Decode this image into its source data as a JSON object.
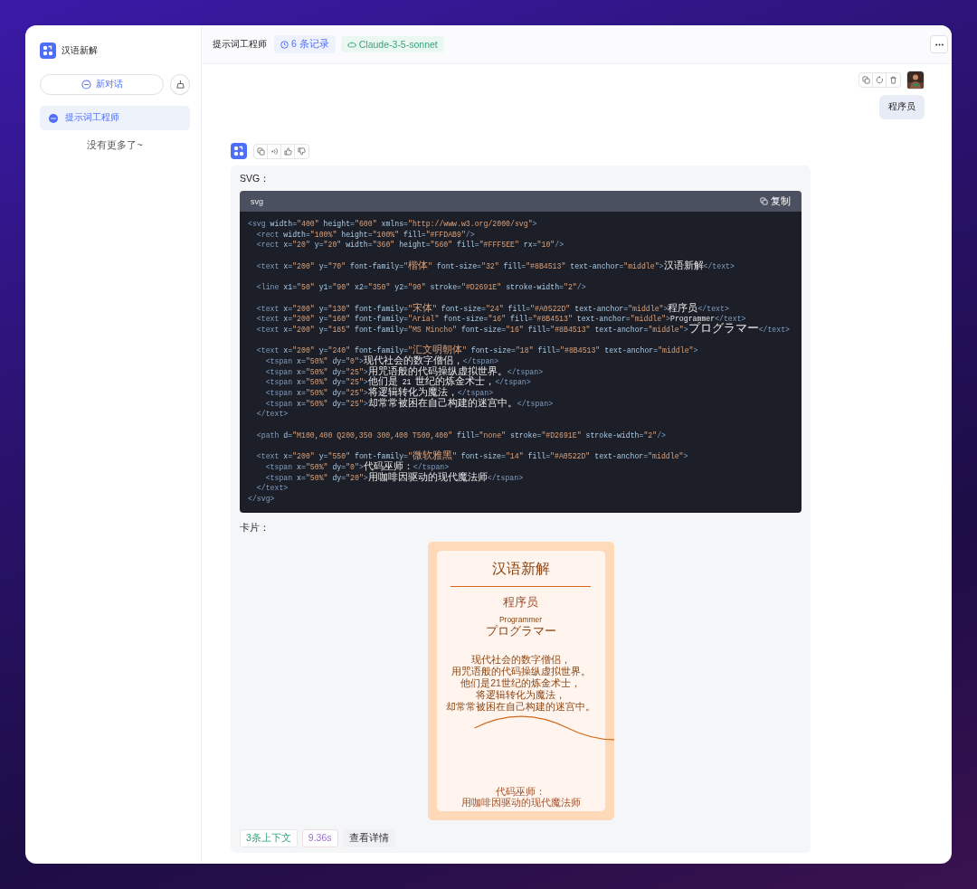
{
  "sidebar": {
    "app_name": "汉语新解",
    "new_chat_button": "新对话",
    "conversations": [
      {
        "title": "提示词工程师",
        "selected": true
      }
    ],
    "end_note": "没有更多了~"
  },
  "header": {
    "title": "提示词工程师",
    "badges": [
      {
        "kind": "records",
        "text": "6 条记录"
      },
      {
        "kind": "model",
        "text": "Claude-3-5-sonnet"
      }
    ]
  },
  "user_message": {
    "text": "程序员"
  },
  "assistant_message": {
    "blocks": [
      {
        "kind": "paragraph",
        "text": "SVG："
      },
      {
        "kind": "code",
        "language": "svg",
        "copy_label": "复制",
        "code": "<svg width=\"400\" height=\"600\" xmlns=\"http://www.w3.org/2000/svg\">\n  <rect width=\"100%\" height=\"100%\" fill=\"#FFDAB9\"/>\n  <rect x=\"20\" y=\"20\" width=\"360\" height=\"560\" fill=\"#FFF5EE\" rx=\"10\"/>\n\n  <text x=\"200\" y=\"70\" font-family=\"楷体\" font-size=\"32\" fill=\"#8B4513\" text-anchor=\"middle\">汉语新解</text>\n\n  <line x1=\"50\" y1=\"90\" x2=\"350\" y2=\"90\" stroke=\"#D2691E\" stroke-width=\"2\"/>\n\n  <text x=\"200\" y=\"130\" font-family=\"宋体\" font-size=\"24\" fill=\"#A0522D\" text-anchor=\"middle\">程序员</text>\n  <text x=\"200\" y=\"160\" font-family=\"Arial\" font-size=\"16\" fill=\"#8B4513\" text-anchor=\"middle\">Programmer</text>\n  <text x=\"200\" y=\"185\" font-family=\"MS Mincho\" font-size=\"16\" fill=\"#8B4513\" text-anchor=\"middle\">プログラマー</text>\n\n  <text x=\"200\" y=\"240\" font-family=\"汇文明朝体\" font-size=\"18\" fill=\"#8B4513\" text-anchor=\"middle\">\n    <tspan x=\"50%\" dy=\"0\">现代社会的数字僧侣，</tspan>\n    <tspan x=\"50%\" dy=\"25\">用咒语般的代码操纵虚拟世界。</tspan>\n    <tspan x=\"50%\" dy=\"25\">他们是 21 世纪的炼金术士，</tspan>\n    <tspan x=\"50%\" dy=\"25\">将逻辑转化为魔法，</tspan>\n    <tspan x=\"50%\" dy=\"25\">却常常被困在自己构建的迷宫中。</tspan>\n  </text>\n\n  <path d=\"M100,400 Q200,350 300,400 T500,400\" fill=\"none\" stroke=\"#D2691E\" stroke-width=\"2\"/>\n\n  <text x=\"200\" y=\"550\" font-family=\"微软雅黑\" font-size=\"14\" fill=\"#A0522D\" text-anchor=\"middle\">\n    <tspan x=\"50%\" dy=\"0\">代码巫师：</tspan>\n    <tspan x=\"50%\" dy=\"20\">用咖啡因驱动的现代魔法师</tspan>\n  </text>\n</svg>"
      },
      {
        "kind": "paragraph",
        "text": "卡片："
      },
      {
        "kind": "card",
        "title": "汉语新解",
        "word": "程序员",
        "english": "Programmer",
        "japanese": "プログラマー",
        "lines": [
          "现代社会的数字僧侣，",
          "用咒语般的代码操纵虚拟世界。",
          "他们是21世纪的炼金术士，",
          "将逻辑转化为魔法，",
          "却常常被困在自己构建的迷宫中。"
        ],
        "footer_lines": [
          "代码巫师：",
          "用咖啡因驱动的现代魔法师"
        ]
      }
    ],
    "footer": [
      {
        "kind": "context",
        "text": "3条上下文"
      },
      {
        "kind": "duration",
        "text": "9.36s"
      },
      {
        "kind": "details",
        "text": "查看详情"
      }
    ]
  }
}
